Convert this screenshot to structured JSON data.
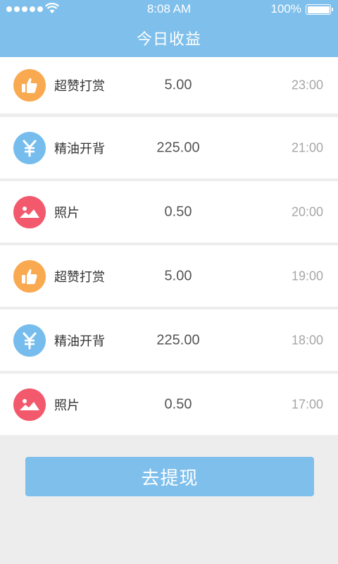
{
  "status_bar": {
    "time": "8:08 AM",
    "battery": "100%"
  },
  "header": {
    "title": "今日收益"
  },
  "records": [
    {
      "type": "thumbs-up",
      "label": "超赞打赏",
      "amount": "5.00",
      "time": "23:00"
    },
    {
      "type": "yuan",
      "label": "精油开背",
      "amount": "225.00",
      "time": "21:00"
    },
    {
      "type": "photo",
      "label": "照片",
      "amount": "0.50",
      "time": "20:00"
    },
    {
      "type": "thumbs-up",
      "label": "超赞打赏",
      "amount": "5.00",
      "time": "19:00"
    },
    {
      "type": "yuan",
      "label": "精油开背",
      "amount": "225.00",
      "time": "18:00"
    },
    {
      "type": "photo",
      "label": "照片",
      "amount": "0.50",
      "time": "17:00"
    }
  ],
  "actions": {
    "withdraw_label": "去提现"
  },
  "colors": {
    "accent": "#7fbfeb",
    "thumbs_icon": "#f9a94f",
    "yuan_icon": "#76bdee",
    "photo_icon": "#f2596c",
    "background": "#ededed"
  },
  "icons": {
    "thumbs-up": "thumbs-up-icon",
    "yuan": "yuan-icon",
    "photo": "photo-icon"
  }
}
